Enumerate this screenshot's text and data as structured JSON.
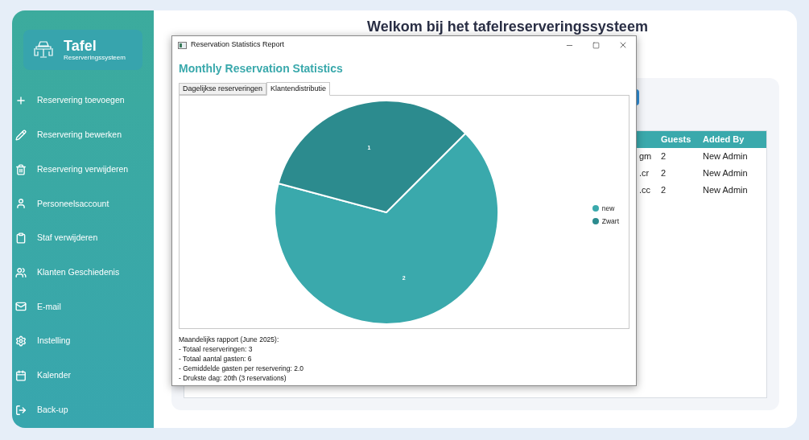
{
  "sidebar": {
    "logo": {
      "title": "Tafel",
      "subtitle": "Reserveringssysteem"
    },
    "items": [
      {
        "label": "Reservering toevoegen"
      },
      {
        "label": "Reservering bewerken"
      },
      {
        "label": "Reservering verwijderen"
      },
      {
        "label": "Personeelsaccount"
      },
      {
        "label": "Staf verwijderen"
      },
      {
        "label": "Klanten Geschiedenis"
      },
      {
        "label": "E-mail"
      },
      {
        "label": "Instelling"
      },
      {
        "label": "Kalender"
      },
      {
        "label": "Back-up"
      }
    ]
  },
  "main": {
    "title": "Welkom bij het tafelreserveringssysteem",
    "table": {
      "columns": [
        "Guests",
        "Added By"
      ],
      "rows": [
        {
          "column_1": "gm",
          "guests": "2",
          "added_by": "New Admin"
        },
        {
          "column_1": ".cr",
          "guests": "2",
          "added_by": "New Admin"
        },
        {
          "column_1": ".cc",
          "guests": "2",
          "added_by": "New Admin"
        }
      ]
    }
  },
  "dialog": {
    "title": "Reservation Statistics Report",
    "heading": "Monthly Reservation Statistics",
    "tabs": [
      {
        "label": "Dagelijkse reserveringen",
        "selected": false
      },
      {
        "label": "Klantendistributie",
        "selected": true
      }
    ],
    "chart_data": {
      "type": "pie",
      "categories": [
        "new",
        "Zwart"
      ],
      "values": [
        2,
        1
      ],
      "colors": [
        "#3aa9ac",
        "#2c8b8e"
      ],
      "data_labels": true,
      "legend": "right"
    },
    "report": [
      "Maandelijks rapport (June 2025):",
      "- Totaal reserveringen: 3",
      "- Totaal aantal gasten: 6",
      "- Gemiddelde gasten per reservering: 2.0",
      "- Drukste dag: 20th (3 reservations)"
    ]
  }
}
